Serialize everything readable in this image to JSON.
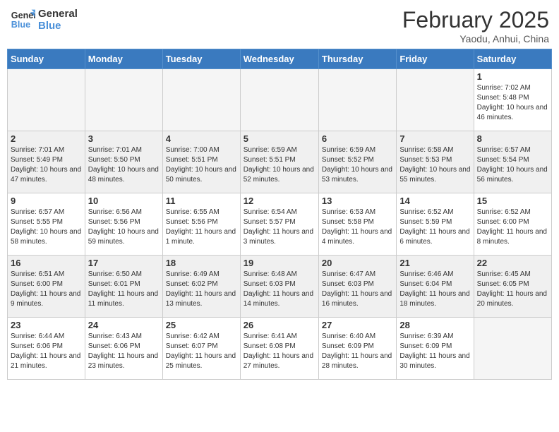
{
  "header": {
    "logo_line1": "General",
    "logo_line2": "Blue",
    "month": "February 2025",
    "location": "Yaodu, Anhui, China"
  },
  "weekdays": [
    "Sunday",
    "Monday",
    "Tuesday",
    "Wednesday",
    "Thursday",
    "Friday",
    "Saturday"
  ],
  "weeks": [
    [
      {
        "day": "",
        "info": ""
      },
      {
        "day": "",
        "info": ""
      },
      {
        "day": "",
        "info": ""
      },
      {
        "day": "",
        "info": ""
      },
      {
        "day": "",
        "info": ""
      },
      {
        "day": "",
        "info": ""
      },
      {
        "day": "1",
        "info": "Sunrise: 7:02 AM\nSunset: 5:48 PM\nDaylight: 10 hours and 46 minutes."
      }
    ],
    [
      {
        "day": "2",
        "info": "Sunrise: 7:01 AM\nSunset: 5:49 PM\nDaylight: 10 hours and 47 minutes."
      },
      {
        "day": "3",
        "info": "Sunrise: 7:01 AM\nSunset: 5:50 PM\nDaylight: 10 hours and 48 minutes."
      },
      {
        "day": "4",
        "info": "Sunrise: 7:00 AM\nSunset: 5:51 PM\nDaylight: 10 hours and 50 minutes."
      },
      {
        "day": "5",
        "info": "Sunrise: 6:59 AM\nSunset: 5:51 PM\nDaylight: 10 hours and 52 minutes."
      },
      {
        "day": "6",
        "info": "Sunrise: 6:59 AM\nSunset: 5:52 PM\nDaylight: 10 hours and 53 minutes."
      },
      {
        "day": "7",
        "info": "Sunrise: 6:58 AM\nSunset: 5:53 PM\nDaylight: 10 hours and 55 minutes."
      },
      {
        "day": "8",
        "info": "Sunrise: 6:57 AM\nSunset: 5:54 PM\nDaylight: 10 hours and 56 minutes."
      }
    ],
    [
      {
        "day": "9",
        "info": "Sunrise: 6:57 AM\nSunset: 5:55 PM\nDaylight: 10 hours and 58 minutes."
      },
      {
        "day": "10",
        "info": "Sunrise: 6:56 AM\nSunset: 5:56 PM\nDaylight: 10 hours and 59 minutes."
      },
      {
        "day": "11",
        "info": "Sunrise: 6:55 AM\nSunset: 5:56 PM\nDaylight: 11 hours and 1 minute."
      },
      {
        "day": "12",
        "info": "Sunrise: 6:54 AM\nSunset: 5:57 PM\nDaylight: 11 hours and 3 minutes."
      },
      {
        "day": "13",
        "info": "Sunrise: 6:53 AM\nSunset: 5:58 PM\nDaylight: 11 hours and 4 minutes."
      },
      {
        "day": "14",
        "info": "Sunrise: 6:52 AM\nSunset: 5:59 PM\nDaylight: 11 hours and 6 minutes."
      },
      {
        "day": "15",
        "info": "Sunrise: 6:52 AM\nSunset: 6:00 PM\nDaylight: 11 hours and 8 minutes."
      }
    ],
    [
      {
        "day": "16",
        "info": "Sunrise: 6:51 AM\nSunset: 6:00 PM\nDaylight: 11 hours and 9 minutes."
      },
      {
        "day": "17",
        "info": "Sunrise: 6:50 AM\nSunset: 6:01 PM\nDaylight: 11 hours and 11 minutes."
      },
      {
        "day": "18",
        "info": "Sunrise: 6:49 AM\nSunset: 6:02 PM\nDaylight: 11 hours and 13 minutes."
      },
      {
        "day": "19",
        "info": "Sunrise: 6:48 AM\nSunset: 6:03 PM\nDaylight: 11 hours and 14 minutes."
      },
      {
        "day": "20",
        "info": "Sunrise: 6:47 AM\nSunset: 6:03 PM\nDaylight: 11 hours and 16 minutes."
      },
      {
        "day": "21",
        "info": "Sunrise: 6:46 AM\nSunset: 6:04 PM\nDaylight: 11 hours and 18 minutes."
      },
      {
        "day": "22",
        "info": "Sunrise: 6:45 AM\nSunset: 6:05 PM\nDaylight: 11 hours and 20 minutes."
      }
    ],
    [
      {
        "day": "23",
        "info": "Sunrise: 6:44 AM\nSunset: 6:06 PM\nDaylight: 11 hours and 21 minutes."
      },
      {
        "day": "24",
        "info": "Sunrise: 6:43 AM\nSunset: 6:06 PM\nDaylight: 11 hours and 23 minutes."
      },
      {
        "day": "25",
        "info": "Sunrise: 6:42 AM\nSunset: 6:07 PM\nDaylight: 11 hours and 25 minutes."
      },
      {
        "day": "26",
        "info": "Sunrise: 6:41 AM\nSunset: 6:08 PM\nDaylight: 11 hours and 27 minutes."
      },
      {
        "day": "27",
        "info": "Sunrise: 6:40 AM\nSunset: 6:09 PM\nDaylight: 11 hours and 28 minutes."
      },
      {
        "day": "28",
        "info": "Sunrise: 6:39 AM\nSunset: 6:09 PM\nDaylight: 11 hours and 30 minutes."
      },
      {
        "day": "",
        "info": ""
      }
    ]
  ]
}
